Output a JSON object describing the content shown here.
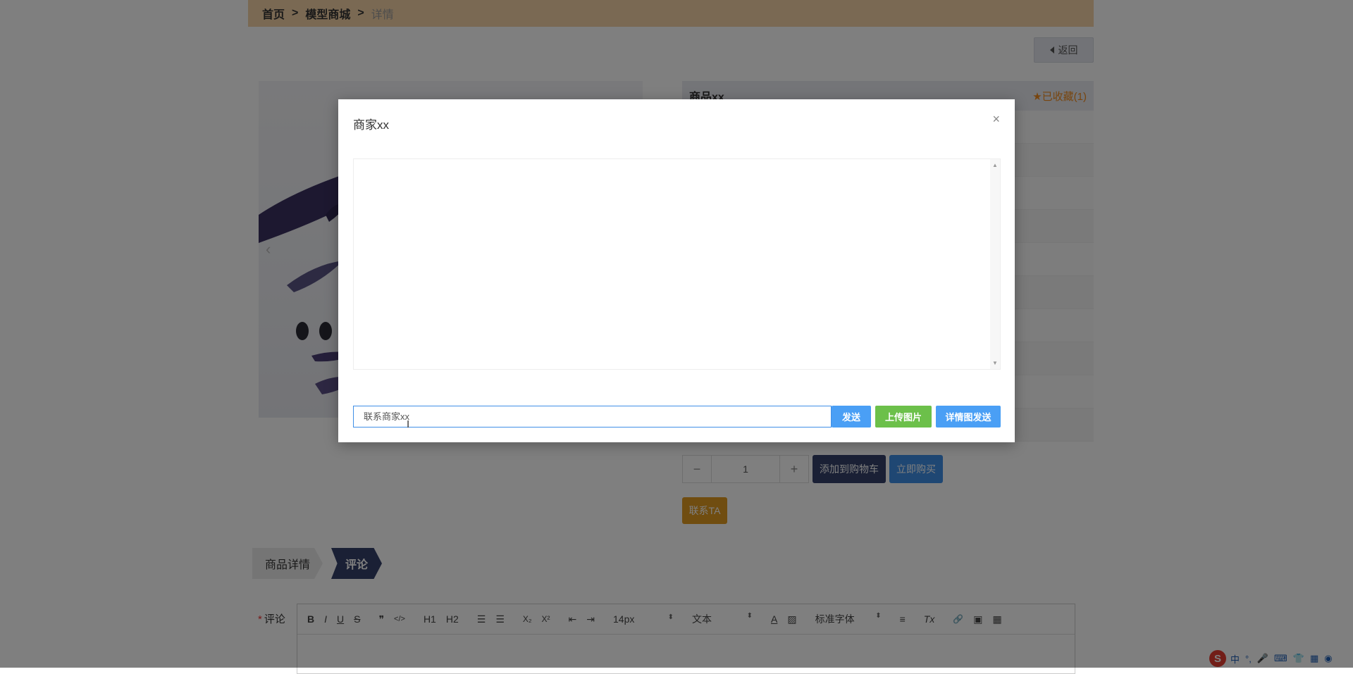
{
  "breadcrumb": {
    "home": "首页",
    "sep": ">",
    "mall": "模型商城",
    "current": "详情"
  },
  "back_button": {
    "label": "返回"
  },
  "product": {
    "name": "商品xx",
    "favorite": "已收藏(1)",
    "quantity": "1",
    "minus": "−",
    "plus": "+",
    "add_to_cart": "添加到购物车",
    "buy_now": "立即购买",
    "contact": "联系TA"
  },
  "gallery": {
    "prev_arrow": "‹"
  },
  "tabs": {
    "details": "商品详情",
    "comments": "评论"
  },
  "comment": {
    "label": "评论",
    "required_mark": "*",
    "toolbar": {
      "bold": "B",
      "italic": "I",
      "underline": "U",
      "strike": "S",
      "quote": "❞",
      "code": "</>",
      "h1": "H1",
      "h2": "H2",
      "ol": "☰",
      "ul": "☰",
      "sub": "X₂",
      "sup": "X²",
      "outdent": "⇤",
      "indent": "⇥",
      "font_size": "14px",
      "block": "文本",
      "font_family": "标准字体",
      "align": "≡",
      "clear": "Tx",
      "link": "🔗",
      "image": "▣",
      "video": "▦"
    }
  },
  "modal": {
    "title": "商家xx",
    "close": "×",
    "input_value": "联系商家xx",
    "send": "发送",
    "upload": "上传图片",
    "detail_send": "详情图发送"
  },
  "ime": {
    "logo": "S",
    "lang": "中",
    "punct": "°,",
    "mic": "🎤",
    "keyboard": "⌨",
    "skin": "👕",
    "apps": "▦",
    "more": "◉"
  },
  "colors": {
    "breadcrumb_bg": "#f4d3a6",
    "accent_blue": "#4a9ff5",
    "accent_green": "#6cc04a",
    "navy": "#34406a",
    "orange": "#e19a21",
    "favorite": "#f08a1c"
  }
}
